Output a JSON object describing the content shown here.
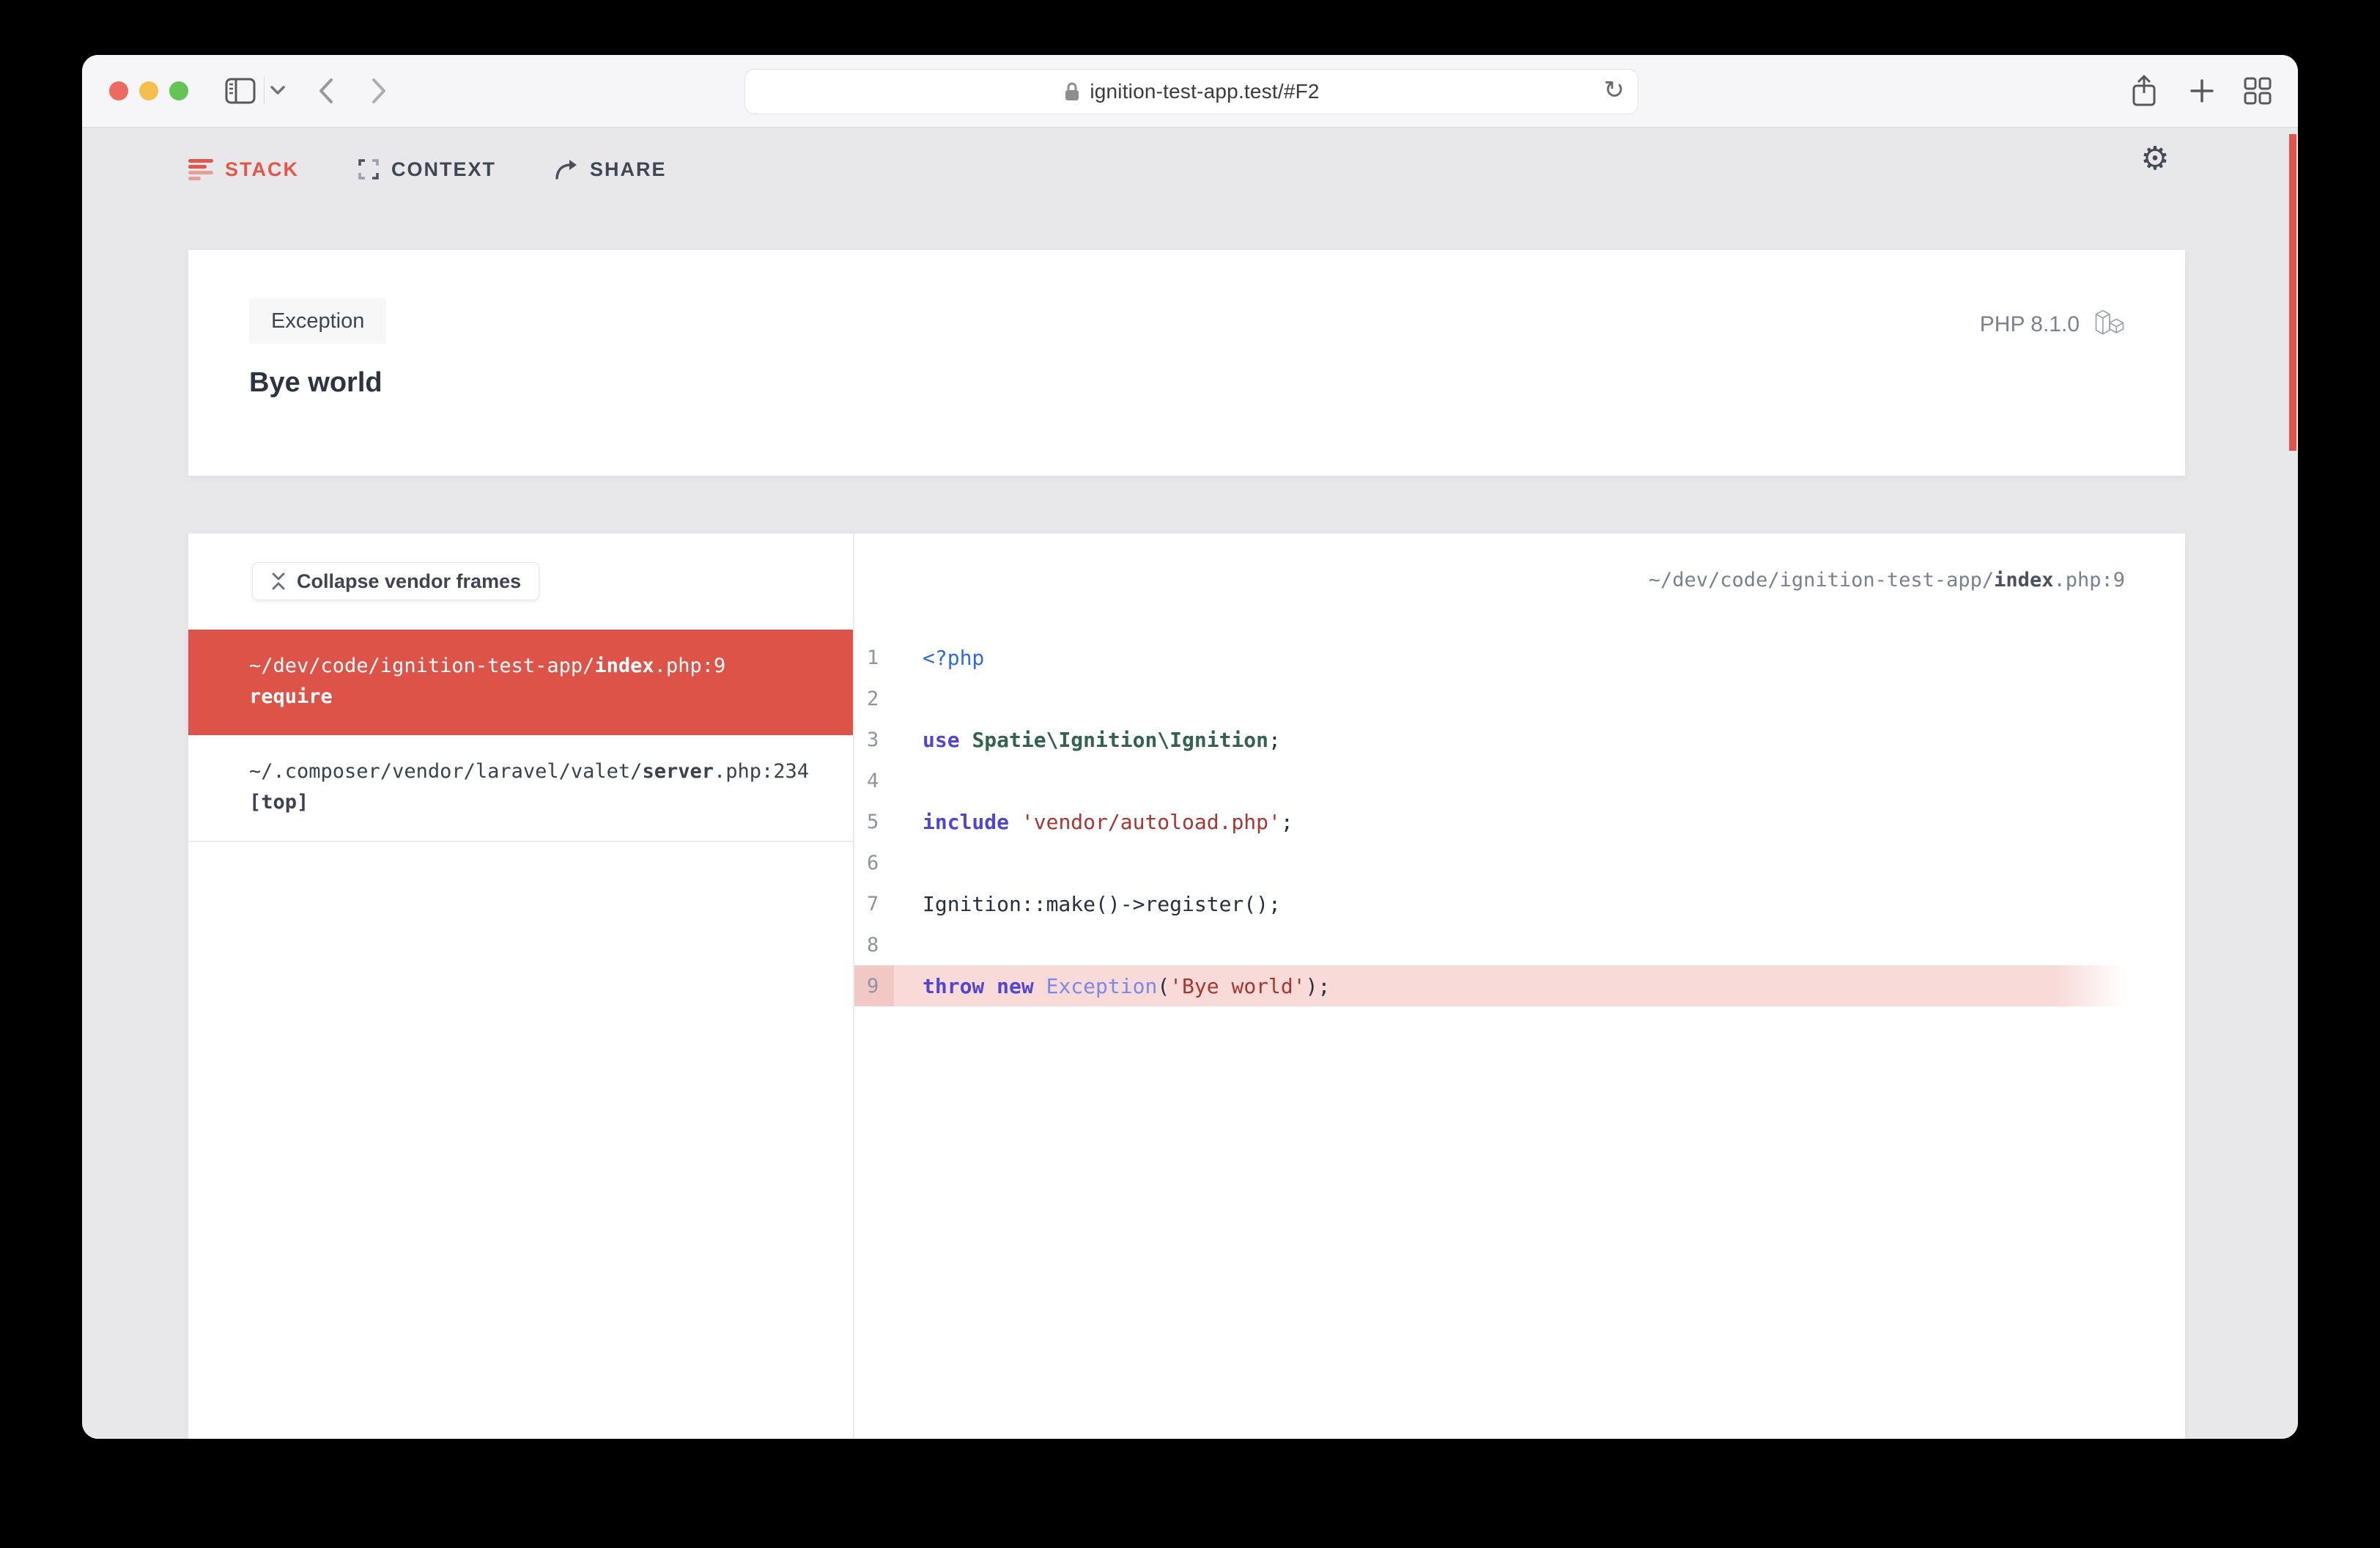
{
  "browser": {
    "url": "ignition-test-app.test/#F2",
    "toolbar_icons": [
      "sidebar-icon",
      "chevron-down-icon",
      "back-icon",
      "forward-icon",
      "lock-icon",
      "reload-icon",
      "share-icon",
      "new-tab-icon",
      "tab-overview-icon"
    ]
  },
  "tabs": [
    {
      "label": "STACK",
      "active": true,
      "icon": "stack-icon"
    },
    {
      "label": "CONTEXT",
      "active": false,
      "icon": "context-icon"
    },
    {
      "label": "SHARE",
      "active": false,
      "icon": "share-arrow-icon"
    }
  ],
  "settings_icon": "gear-icon",
  "exception": {
    "badge": "Exception",
    "message": "Bye world",
    "php_version": "PHP 8.1.0",
    "framework_icon": "laravel-icon"
  },
  "stack_panel": {
    "collapse_button": "Collapse vendor frames",
    "frames": [
      {
        "path_prefix": "~/dev/code/ignition-test-app/",
        "file": "index",
        "suffix": ".php:9",
        "method": "require",
        "active": true
      },
      {
        "path_prefix": "~/.composer/vendor/laravel/valet/",
        "file": "server",
        "suffix": ".php:234",
        "method": "[top]",
        "active": false
      }
    ]
  },
  "code_panel": {
    "header": {
      "path_prefix": "~/dev/code/ignition-test-app/",
      "file": "index",
      "suffix": ".php:9"
    },
    "lines": [
      {
        "num": "1",
        "highlight": false,
        "tokens": [
          {
            "t": "<?php",
            "c": "php"
          }
        ]
      },
      {
        "num": "2",
        "highlight": false,
        "tokens": []
      },
      {
        "num": "3",
        "highlight": false,
        "tokens": [
          {
            "t": "use",
            "c": "kw"
          },
          {
            "t": " ",
            "c": "plain"
          },
          {
            "t": "Spatie\\Ignition\\Ignition",
            "c": "cls"
          },
          {
            "t": ";",
            "c": "plain"
          }
        ]
      },
      {
        "num": "4",
        "highlight": false,
        "tokens": []
      },
      {
        "num": "5",
        "highlight": false,
        "tokens": [
          {
            "t": "include",
            "c": "kw"
          },
          {
            "t": " ",
            "c": "plain"
          },
          {
            "t": "'vendor/autoload.php'",
            "c": "str"
          },
          {
            "t": ";",
            "c": "plain"
          }
        ]
      },
      {
        "num": "6",
        "highlight": false,
        "tokens": []
      },
      {
        "num": "7",
        "highlight": false,
        "tokens": [
          {
            "t": "Ignition::make()->register();",
            "c": "plain"
          }
        ]
      },
      {
        "num": "8",
        "highlight": false,
        "tokens": []
      },
      {
        "num": "9",
        "highlight": true,
        "tokens": [
          {
            "t": "throw",
            "c": "kw"
          },
          {
            "t": " ",
            "c": "plain"
          },
          {
            "t": "new",
            "c": "kw"
          },
          {
            "t": " ",
            "c": "plain"
          },
          {
            "t": "Exception",
            "c": "exc"
          },
          {
            "t": "(",
            "c": "plain"
          },
          {
            "t": "'Bye world'",
            "c": "str"
          },
          {
            "t": ")",
            "c": "plain"
          },
          {
            "t": ";",
            "c": "plain"
          }
        ]
      }
    ]
  },
  "colors": {
    "accent_red": "#dd5348",
    "scrollbar_red": "#df5449",
    "highlight_pink": "#f8dbd9",
    "gutter_pink": "#f2c8c5",
    "keyword": "#5046d2",
    "class_name": "#33624f",
    "string": "#a93530",
    "php_tag": "#2f6be0",
    "exception_class": "#7c87ea",
    "traffic_red": "#ed6a5e",
    "traffic_yellow": "#f5bf4f",
    "traffic_green": "#62c554"
  }
}
